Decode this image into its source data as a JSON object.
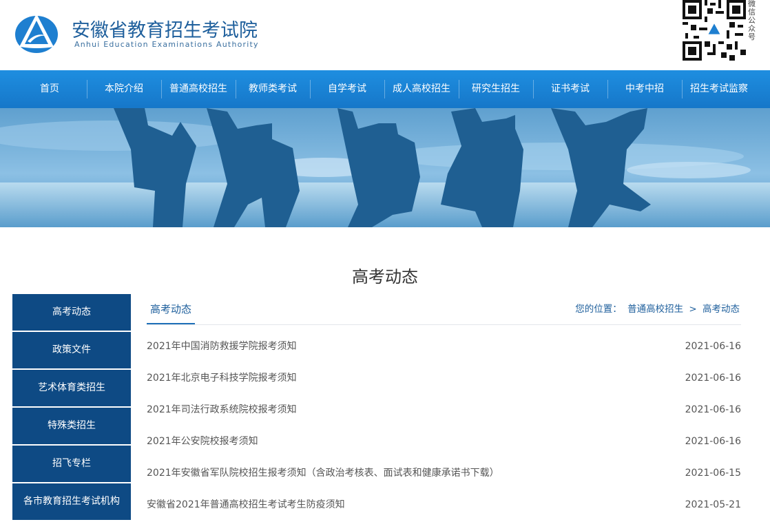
{
  "header": {
    "title": "安徽省教育招生考试院",
    "subtitle": "Anhui Education Examinations Authority",
    "qr_label": "微信公众号"
  },
  "nav": {
    "items": [
      "首页",
      "本院介绍",
      "普通高校招生",
      "教师类考试",
      "自学考试",
      "成人高校招生",
      "研究生招生",
      "证书考试",
      "中考中招",
      "招生考试监察"
    ]
  },
  "section": {
    "title": "高考动态"
  },
  "sidebar": {
    "items": [
      "高考动态",
      "政策文件",
      "艺术体育类招生",
      "特殊类招生",
      "招飞专栏",
      "各市教育招生考试机构"
    ]
  },
  "content": {
    "tab": "高考动态",
    "breadcrumb": {
      "prefix": "您的位置：",
      "parent": "普通高校招生",
      "separator": ">",
      "current": "高考动态"
    },
    "articles": [
      {
        "title": "2021年中国消防救援学院报考须知",
        "date": "2021-06-16"
      },
      {
        "title": "2021年北京电子科技学院报考须知",
        "date": "2021-06-16"
      },
      {
        "title": "2021年司法行政系统院校报考须知",
        "date": "2021-06-16"
      },
      {
        "title": "2021年公安院校报考须知",
        "date": "2021-06-16"
      },
      {
        "title": "2021年安徽省军队院校招生报考须知（含政治考核表、面试表和健康承诺书下载）",
        "date": "2021-06-15"
      },
      {
        "title": "安徽省2021年普通高校招生考试考生防疫须知",
        "date": "2021-05-21"
      }
    ]
  },
  "colors": {
    "nav_blue": "#1677c9",
    "sidebar_navy": "#0e4a84",
    "brand_blue": "#1e5f9c"
  }
}
